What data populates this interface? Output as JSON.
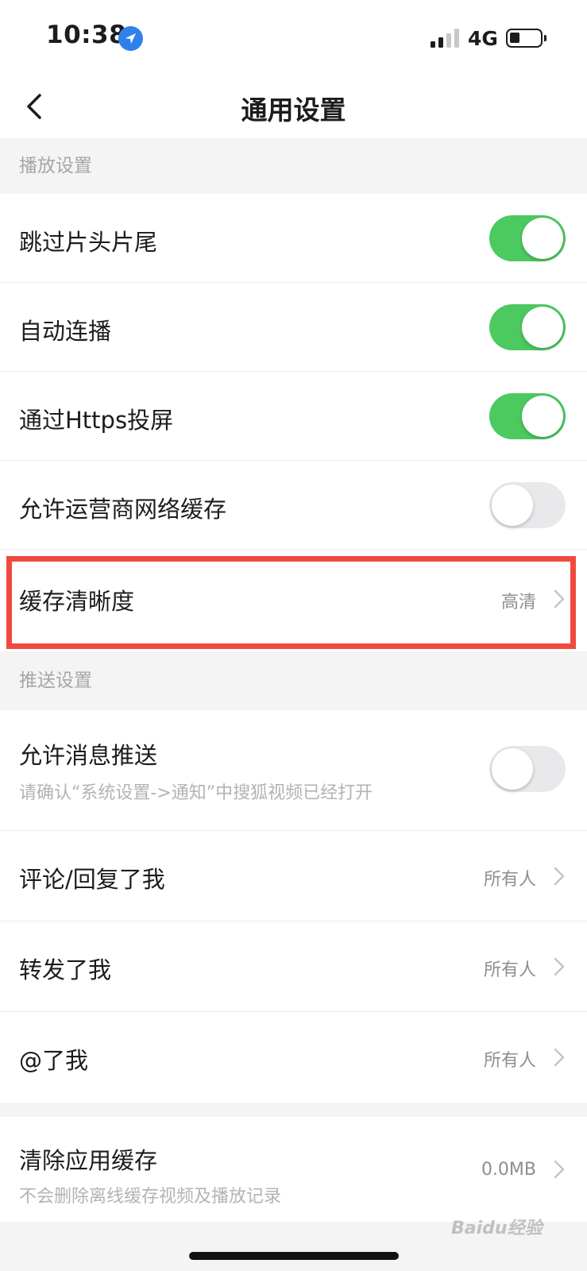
{
  "status_bar": {
    "time": "10:38",
    "network": "4G",
    "location_icon": "location-arrow-icon"
  },
  "nav": {
    "title": "通用设置",
    "back_icon": "chevron-left-icon"
  },
  "sections": {
    "playback": {
      "header": "播放设置",
      "items": [
        {
          "label": "跳过片头片尾",
          "toggle": true
        },
        {
          "label": "自动连播",
          "toggle": true
        },
        {
          "label": "通过Https投屏",
          "toggle": true
        },
        {
          "label": "允许运营商网络缓存",
          "toggle": false
        },
        {
          "label": "缓存清晰度",
          "value": "高清"
        }
      ]
    },
    "push": {
      "header": "推送设置",
      "items": [
        {
          "label": "允许消息推送",
          "subtitle": "请确认“系统设置->通知”中搜狐视频已经打开",
          "toggle": false
        },
        {
          "label": "评论/回复了我",
          "value": "所有人"
        },
        {
          "label": "转发了我",
          "value": "所有人"
        },
        {
          "label": "@了我",
          "value": "所有人"
        }
      ]
    },
    "cache": {
      "items": [
        {
          "label": "清除应用缓存",
          "subtitle": "不会删除离线缓存视频及播放记录",
          "value": "0.0MB"
        }
      ]
    }
  },
  "watermark": "Baidu经验",
  "colors": {
    "toggle_on": "#4cc95f",
    "toggle_off": "#e9e9eb",
    "highlight": "#f04a3f"
  }
}
